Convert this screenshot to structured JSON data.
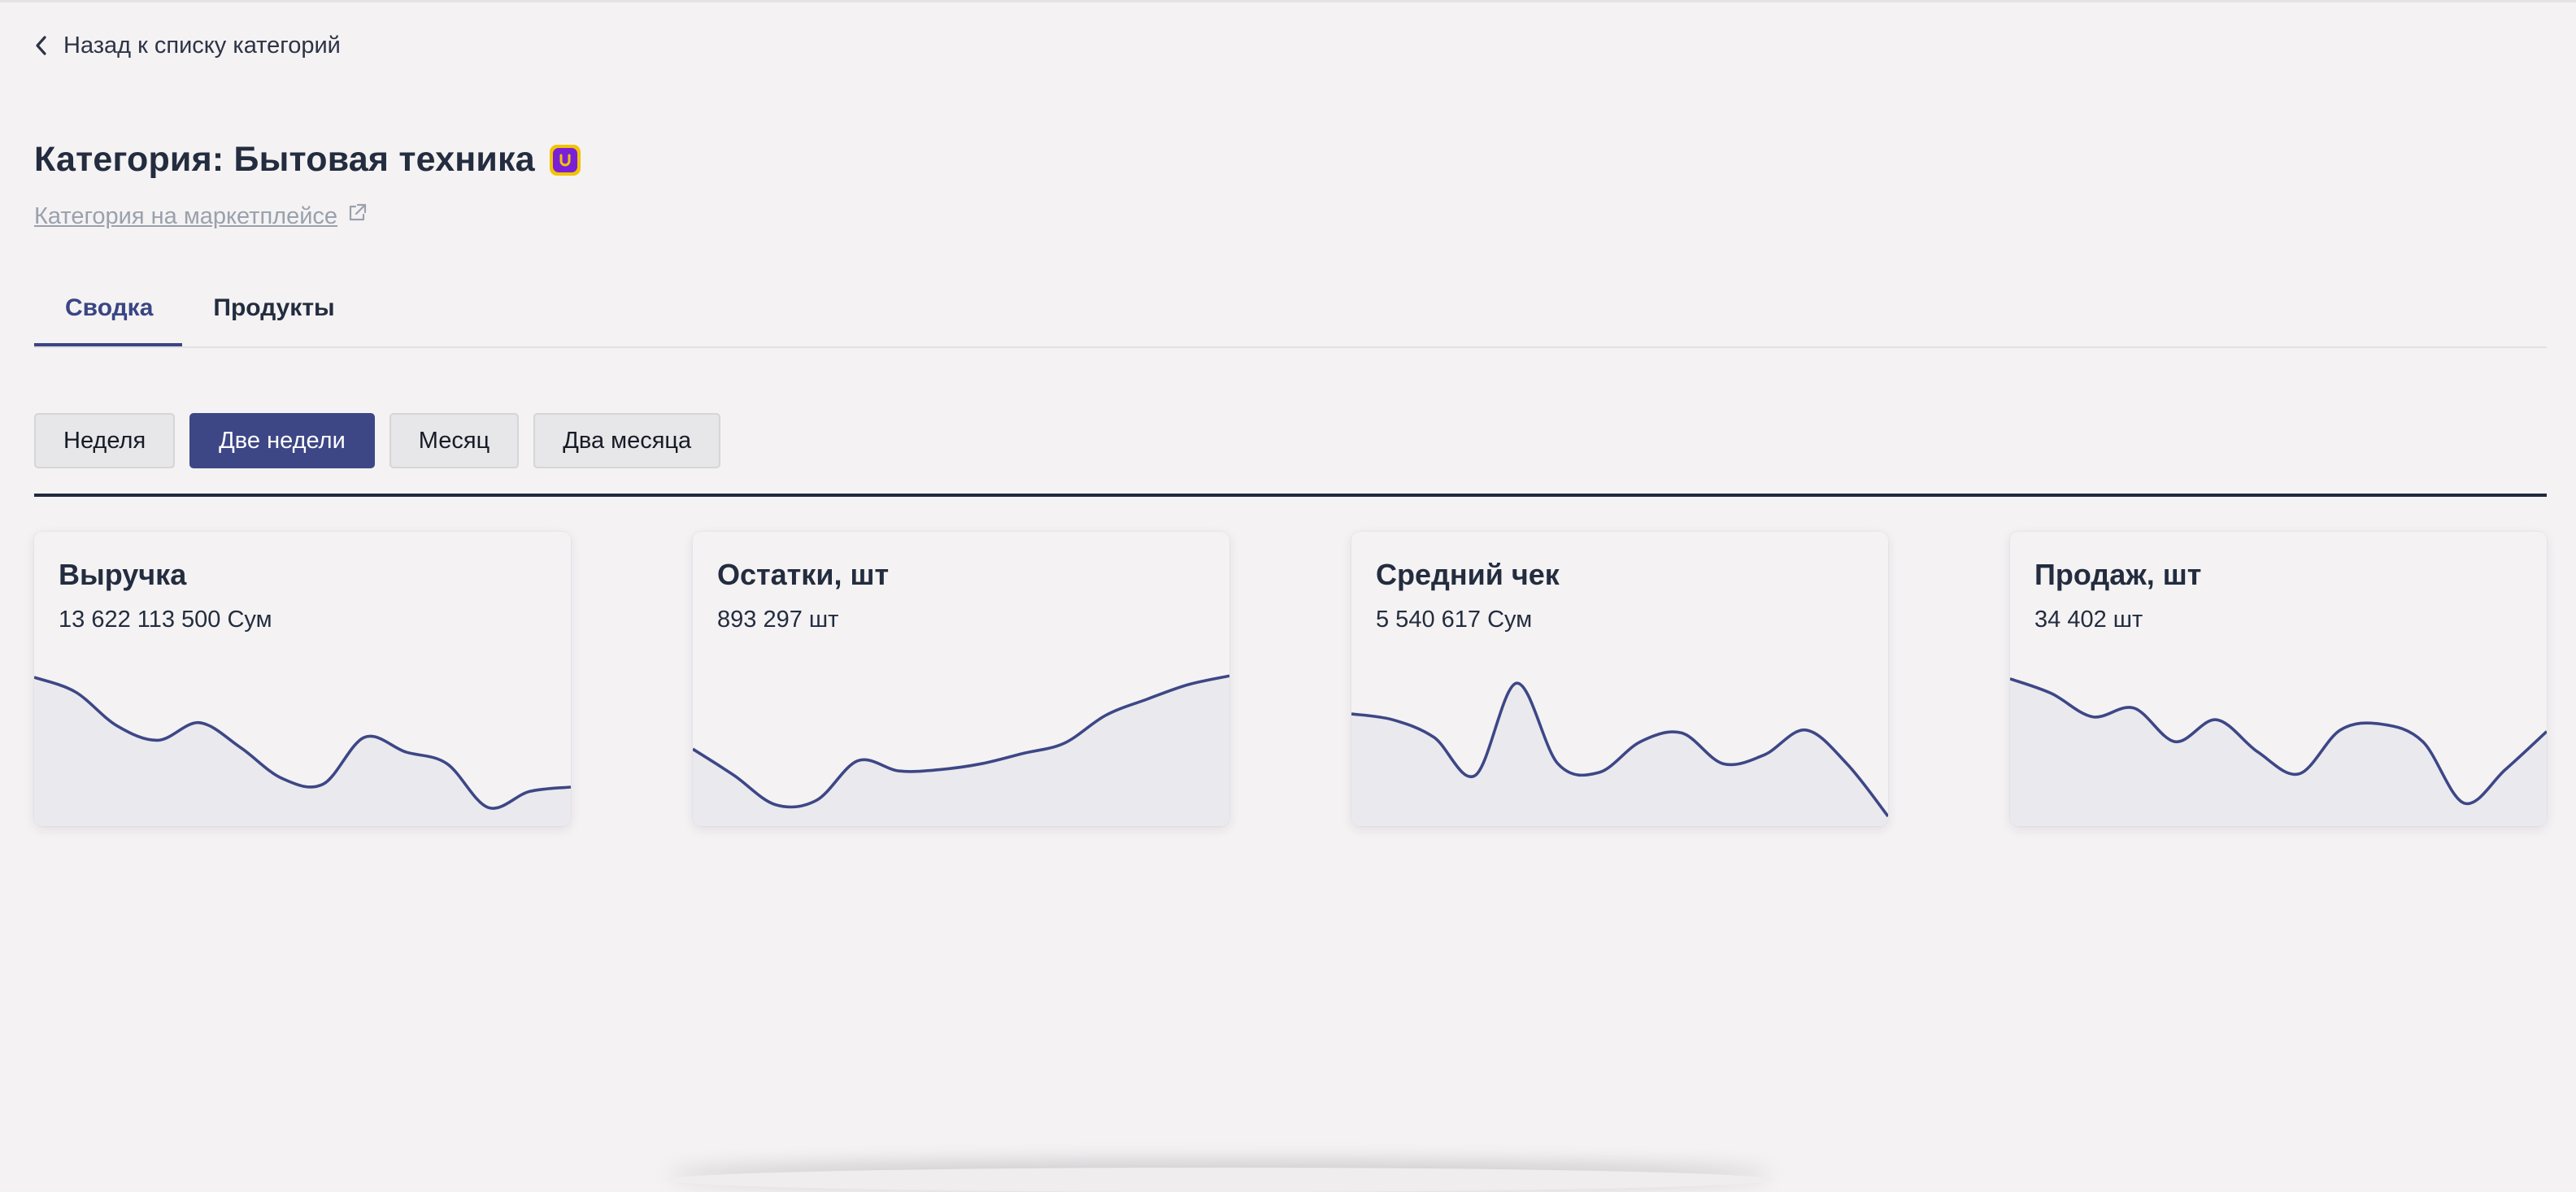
{
  "back_link": {
    "label": "Назад к списку категорий",
    "icon": "chevron-left-icon"
  },
  "page": {
    "title": "Категория: Бытовая техника",
    "marketplace_link": "Категория на маркетплейсе",
    "brand_color": "#7a1fd8",
    "brand_bg": "#f2c400"
  },
  "tabs": [
    {
      "label": "Сводка",
      "active": true
    },
    {
      "label": "Продукты",
      "active": false
    }
  ],
  "periods": [
    {
      "label": "Неделя",
      "active": false
    },
    {
      "label": "Две недели",
      "active": true
    },
    {
      "label": "Месяц",
      "active": false
    },
    {
      "label": "Два месяца",
      "active": false
    }
  ],
  "accent_color": "#3d4786",
  "cards": [
    {
      "title": "Выручка",
      "value": "13 622 113 500 Сум",
      "chart_data": {
        "type": "area",
        "values": [
          0.95,
          0.85,
          0.62,
          0.52,
          0.64,
          0.47,
          0.26,
          0.22,
          0.54,
          0.44,
          0.36,
          0.06,
          0.17,
          0.2
        ]
      }
    },
    {
      "title": "Остатки, шт",
      "value": "893 297 шт",
      "chart_data": {
        "type": "area",
        "values": [
          0.46,
          0.28,
          0.08,
          0.11,
          0.38,
          0.31,
          0.32,
          0.36,
          0.43,
          0.5,
          0.69,
          0.8,
          0.9,
          0.96
        ]
      }
    },
    {
      "title": "Средний чек",
      "value": "5 540 617 Сум",
      "chart_data": {
        "type": "area",
        "values": [
          0.7,
          0.66,
          0.54,
          0.28,
          0.91,
          0.36,
          0.3,
          0.51,
          0.57,
          0.36,
          0.42,
          0.59,
          0.36,
          0.0
        ]
      }
    },
    {
      "title": "Продаж, шт",
      "value": "34 402 шт",
      "chart_data": {
        "type": "area",
        "values": [
          0.94,
          0.84,
          0.68,
          0.74,
          0.51,
          0.66,
          0.44,
          0.29,
          0.59,
          0.63,
          0.51,
          0.09,
          0.32,
          0.58
        ]
      }
    }
  ]
}
